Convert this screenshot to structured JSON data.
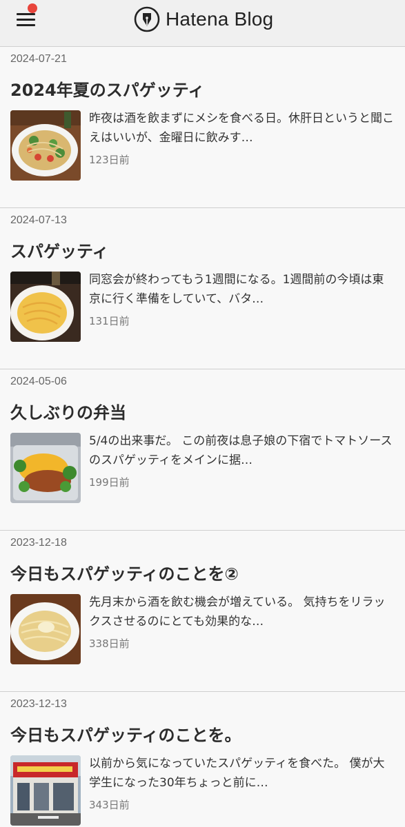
{
  "header": {
    "brand": "Hatena Blog"
  },
  "entries": [
    {
      "date": "2024-07-21",
      "title": "2024年夏のスパゲッティ",
      "excerpt": "昨夜は酒を飲まずにメシを食べる日。休肝日というと聞こえはいいが、金曜日に飲みす…",
      "ago": "123日前",
      "thumb_icon": "pasta-with-vegetables-photo"
    },
    {
      "date": "2024-07-13",
      "title": "スパゲッティ",
      "excerpt": "同窓会が終わってもう1週間になる。1週間前の今頃は東京に行く準備をしていて、バタ…",
      "ago": "131日前",
      "thumb_icon": "cream-pasta-photo"
    },
    {
      "date": "2024-05-06",
      "title": "久しぶりの弁当",
      "excerpt": "5/4の出来事だ。 この前夜は息子娘の下宿でトマトソースのスパゲッティをメインに据…",
      "ago": "199日前",
      "thumb_icon": "omelette-bento-photo"
    },
    {
      "date": "2023-12-18",
      "title": "今日もスパゲッティのことを②",
      "excerpt": "先月末から酒を飲む機会が増えている。 気持ちをリラックスさせるのにとても効果的な…",
      "ago": "338日前",
      "thumb_icon": "cheese-pasta-photo"
    },
    {
      "date": "2023-12-13",
      "title": "今日もスパゲッティのことを。",
      "excerpt": "以前から気になっていたスパゲッティを食べた。 僕が大学生になった30年ちょっと前に…",
      "ago": "343日前",
      "thumb_icon": "restaurant-storefront-photo"
    }
  ]
}
